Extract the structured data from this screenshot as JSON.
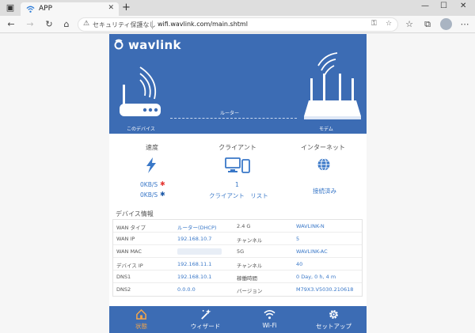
{
  "browser": {
    "tab_title": "APP",
    "address_security": "セキュリティ保護なし",
    "address_url": "wifi.wavlink.com/main.shtml"
  },
  "brand": {
    "logo_text": "wavlink",
    "accent": "#3c6cb4",
    "active_color": "#f4a64a"
  },
  "hero": {
    "this_device": "このデバイス",
    "router": "ルーター",
    "modem": "モデム"
  },
  "stats": {
    "speed_title": "速度",
    "speed_up": "0KB/S",
    "speed_down": "0KB/S",
    "clients_title": "クライアント",
    "client_count": "1",
    "client_list_link": "クライアント　リスト",
    "internet_title": "インターネット",
    "internet_status": "接続済み"
  },
  "device_info": {
    "heading": "デバイス情報",
    "rows": [
      {
        "l1": "WAN タイプ",
        "v1": "ルーター(DHCP)",
        "l2": "2.4 G",
        "v2": "WAVLINK-N"
      },
      {
        "l1": "WAN IP",
        "v1": "192.168.10.7",
        "l2": "チャンネル",
        "v2": "5"
      },
      {
        "l1": "WAN MAC",
        "v1": "",
        "l2": "5G",
        "v2": "WAVLINK-AC"
      },
      {
        "l1": "デバイス IP",
        "v1": "192.168.11.1",
        "l2": "チャンネル",
        "v2": "40"
      },
      {
        "l1": "DNS1",
        "v1": "192.168.10.1",
        "l2": "稼働時間",
        "v2": "0 Day, 0 h, 4 m"
      },
      {
        "l1": "DNS2",
        "v1": "0.0.0.0",
        "l2": "バージョン",
        "v2": "M79X3.V5030.210618"
      }
    ]
  },
  "nav": {
    "status": "状態",
    "wizard": "ウィザード",
    "wifi": "Wi-Fi",
    "setup": "セットアップ"
  }
}
